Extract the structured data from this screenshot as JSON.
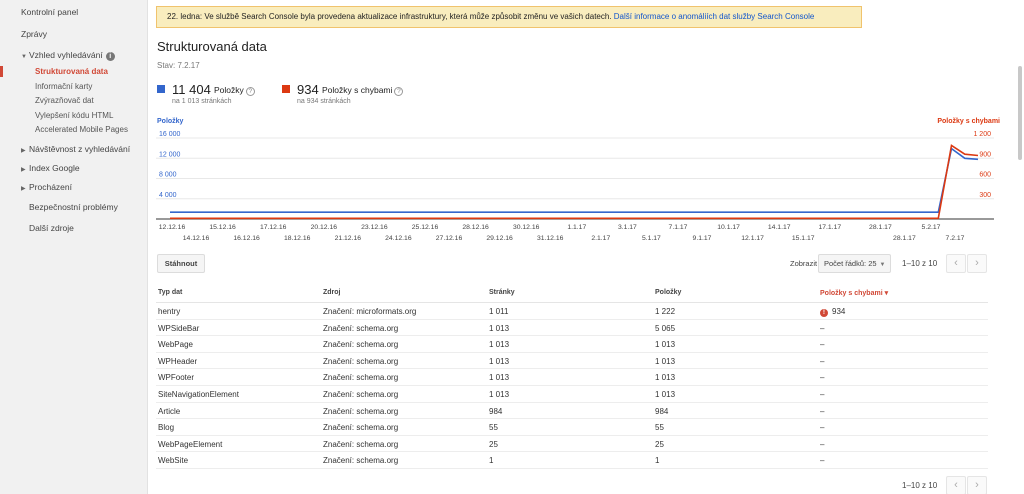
{
  "sidebar": {
    "top_items": [
      "Kontrolní panel",
      "Zprávy"
    ],
    "appearance": {
      "label": "Vzhled vyhledávání",
      "info": "i",
      "sub": [
        "Strukturovaná data",
        "Informační karty",
        "Zvýrazňovač dat",
        "Vylepšení kódu HTML",
        "Accelerated Mobile Pages"
      ]
    },
    "groups": [
      "Návštěvnost z vyhledávání",
      "Index Google",
      "Procházení"
    ],
    "bottom_items": [
      "Bezpečnostní problémy",
      "Další zdroje"
    ]
  },
  "banner": {
    "text": "22. ledna: Ve službě Search Console byla provedena aktualizace infrastruktury, která může způsobit změnu ve vašich datech.",
    "link": "Další informace o anomáliích dat služby Search Console"
  },
  "page": {
    "title": "Strukturovaná data",
    "state": "Stav: 7.2.17"
  },
  "stats": {
    "items": {
      "value": "11 404",
      "label": "Položky",
      "sub": "na 1 013 stránkách",
      "color": "#3366cc"
    },
    "errors": {
      "value": "934",
      "label": "Položky s chybami",
      "sub": "na 934 stránkách",
      "color": "#dc3912"
    },
    "help": "?"
  },
  "chart_data": {
    "type": "line",
    "left_axis_title": "Položky",
    "right_axis_title": "Položky s chybami",
    "left_ticks": [
      "16 000",
      "12 000",
      "8 000",
      "4 000"
    ],
    "right_ticks": [
      "1 200",
      "900",
      "600",
      "300"
    ],
    "ylim_left": [
      0,
      16000
    ],
    "ylim_right": [
      0,
      1200
    ],
    "x_labels_top": [
      "12.12.16",
      "15.12.16",
      "17.12.16",
      "20.12.16",
      "23.12.16",
      "25.12.16",
      "28.12.16",
      "30.12.16",
      "1.1.17",
      "3.1.17",
      "7.1.17",
      "10.1.17",
      "14.1.17",
      "17.1.17",
      "28.1.17",
      "5.2.17"
    ],
    "x_labels_bottom": [
      "14.12.16",
      "16.12.16",
      "18.12.16",
      "21.12.16",
      "24.12.16",
      "27.12.16",
      "29.12.16",
      "31.12.16",
      "2.1.17",
      "5.1.17",
      "9.1.17",
      "12.1.17",
      "15.1.17",
      "",
      "28.1.17",
      "7.2.17"
    ],
    "series": [
      {
        "name": "Položky",
        "color": "#3366cc",
        "axis": "left",
        "values": [
          1350,
          1350,
          1350,
          1350,
          1350,
          1350,
          1350,
          1350,
          1350,
          1350,
          1350,
          1350,
          1350,
          1350,
          1350,
          1350,
          1350,
          1350,
          1350,
          1350,
          1350,
          1350,
          1350,
          1350,
          1350,
          1350,
          1350,
          1350,
          1350,
          1350,
          1350,
          1350,
          1350,
          1350,
          1350,
          1350,
          1350,
          1350,
          1350,
          1350,
          1350,
          1350,
          1350,
          1350,
          1350,
          1350,
          1350,
          1350,
          1350,
          1350,
          1350,
          1350,
          1350,
          1350,
          1350,
          1350,
          1350,
          1350,
          1350,
          13900,
          12000,
          11800
        ]
      },
      {
        "name": "Položky s chybami",
        "color": "#dc3912",
        "axis": "right",
        "values": [
          10,
          10,
          10,
          10,
          10,
          10,
          10,
          10,
          10,
          10,
          10,
          10,
          10,
          10,
          10,
          10,
          10,
          10,
          10,
          10,
          10,
          10,
          10,
          10,
          10,
          10,
          10,
          10,
          10,
          10,
          10,
          10,
          10,
          10,
          10,
          10,
          10,
          10,
          10,
          10,
          10,
          10,
          10,
          10,
          10,
          10,
          10,
          10,
          10,
          10,
          10,
          10,
          10,
          10,
          10,
          10,
          10,
          10,
          10,
          1090,
          960,
          940
        ]
      }
    ],
    "grid": true
  },
  "toolbar": {
    "download": "Stáhnout",
    "show": "Zobrazit",
    "rows": "Počet řádků: 25",
    "range": "1–10 z 10",
    "prev": "‹",
    "next": "›"
  },
  "table": {
    "headers": [
      "Typ dat",
      "Zdroj",
      "Stránky",
      "Položky",
      "Položky s chybami"
    ],
    "sort_arrow": "▾",
    "rows": [
      [
        "hentry",
        "Značení: microformats.org",
        "1 011",
        "1 222",
        "934"
      ],
      [
        "WPSideBar",
        "Značení: schema.org",
        "1 013",
        "5 065",
        "–"
      ],
      [
        "WebPage",
        "Značení: schema.org",
        "1 013",
        "1 013",
        "–"
      ],
      [
        "WPHeader",
        "Značení: schema.org",
        "1 013",
        "1 013",
        "–"
      ],
      [
        "WPFooter",
        "Značení: schema.org",
        "1 013",
        "1 013",
        "–"
      ],
      [
        "SiteNavigationElement",
        "Značení: schema.org",
        "1 013",
        "1 013",
        "–"
      ],
      [
        "Article",
        "Značení: schema.org",
        "984",
        "984",
        "–"
      ],
      [
        "Blog",
        "Značení: schema.org",
        "55",
        "55",
        "–"
      ],
      [
        "WebPageElement",
        "Značení: schema.org",
        "25",
        "25",
        "–"
      ],
      [
        "WebSite",
        "Značení: schema.org",
        "1",
        "1",
        "–"
      ]
    ],
    "error_icon": "!"
  }
}
